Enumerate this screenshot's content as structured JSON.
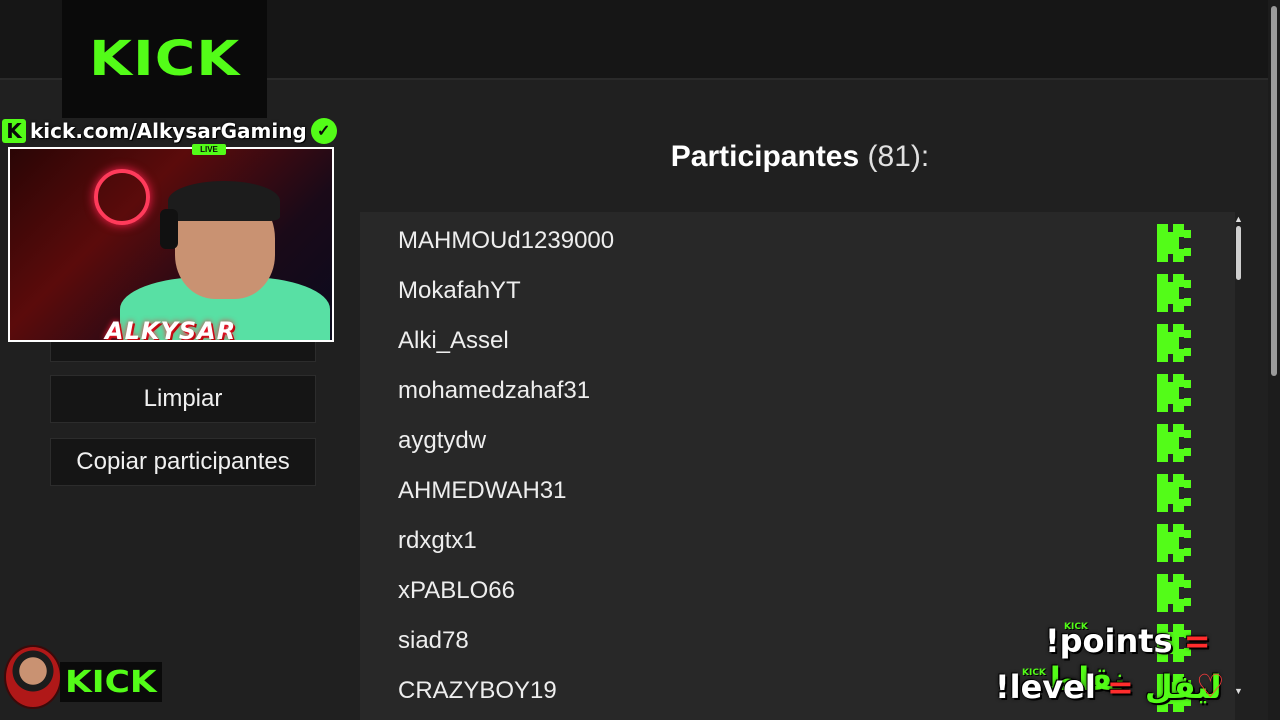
{
  "overlay": {
    "kick_logo": "KICK",
    "k_badge": "K",
    "channel_url": "kick.com/AlkysarGaming",
    "verified_mark": "✓",
    "live_label": "LIVE",
    "streamer_name": "ALKYSAR",
    "bottom_logo": "KICK",
    "tiny_kick": "KICK",
    "points_command": "!points",
    "points_eq": "=",
    "points_arabic": "نقاط",
    "level_command": "!level",
    "level_eq": "=",
    "level_arabic": "ليفل",
    "heart": "♡"
  },
  "sidebar": {
    "clear_label": "Limpiar",
    "copy_label": "Copiar participantes"
  },
  "main": {
    "title_label": "Participantes",
    "title_count": "(81):",
    "participants": [
      "MAHMOUd1239000",
      "MokafahYT",
      "Alki_Assel",
      "mohamedzahaf31",
      "aygtydw",
      "AHMEDWAH31",
      "rdxgtx1",
      "xPABLO66",
      "siad78",
      "CRAZYBOY19"
    ]
  },
  "colors": {
    "kick_green": "#53fc18",
    "background": "#202020",
    "panel": "#282828"
  },
  "icons": {
    "platform_icon": "kick-k-icon",
    "scroll_up": "▲",
    "scroll_down": "▼"
  }
}
